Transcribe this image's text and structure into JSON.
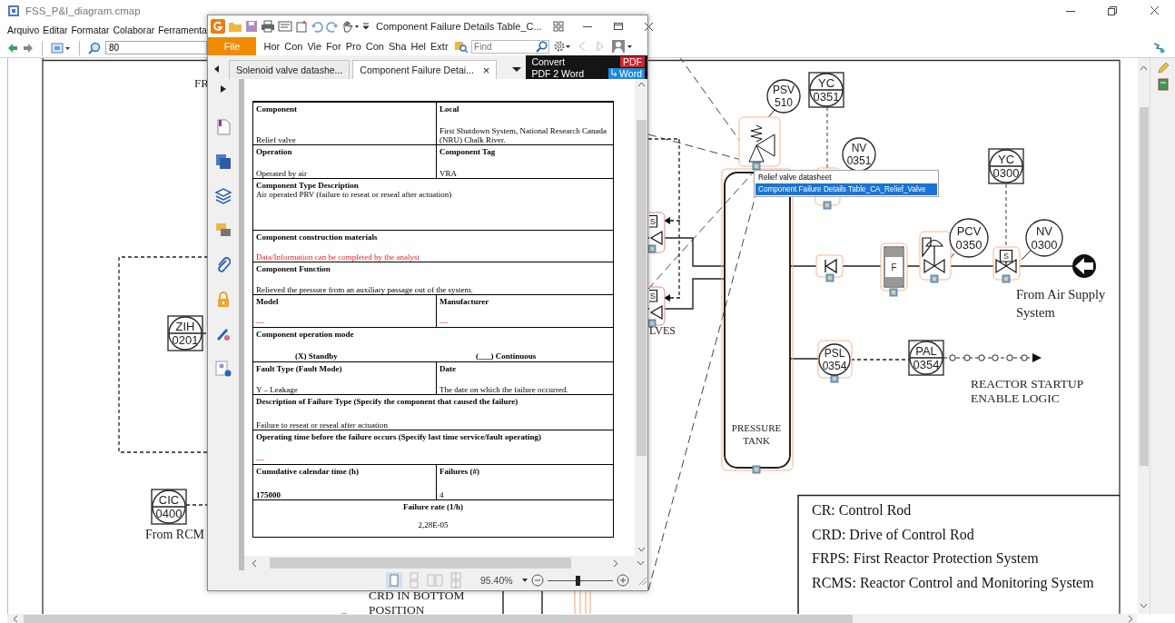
{
  "window": {
    "title": "FSS_P&I_diagram.cmap"
  },
  "menu": [
    "Arquivo",
    "Editar",
    "Formatar",
    "Colaborar",
    "Ferramenta"
  ],
  "toolbar": {
    "zoom_value": "80"
  },
  "diagram": {
    "instruments": [
      {
        "kind": "field",
        "tag": "PSV",
        "number": "510"
      },
      {
        "kind": "panel",
        "tag": "YC",
        "number": "0351"
      },
      {
        "kind": "field",
        "tag": "NV",
        "number": "0351"
      },
      {
        "kind": "panel",
        "tag": "YC",
        "number": "0300"
      },
      {
        "kind": "field",
        "tag": "PCV",
        "number": "0350"
      },
      {
        "kind": "field",
        "tag": "NV",
        "number": "0300"
      },
      {
        "kind": "field",
        "tag": "PSL",
        "number": "0354"
      },
      {
        "kind": "panel",
        "tag": "PAL",
        "number": "0354"
      },
      {
        "kind": "panel",
        "tag": "ZIH",
        "number": "0201"
      },
      {
        "kind": "panel",
        "tag": "CIC",
        "number": "0400"
      }
    ],
    "valve_marks": [
      "S",
      "S",
      "F",
      "S"
    ],
    "labels": [
      {
        "lines": [
          "FR"
        ]
      },
      {
        "lines": [
          "LVES"
        ]
      },
      {
        "lines": [
          "From RCM"
        ]
      },
      {
        "lines": [
          "CRD IN BOTTOM",
          "POSITION"
        ]
      },
      {
        "lines": [
          "PRESSURE",
          "TANK"
        ]
      },
      {
        "lines": [
          "From Air Supply",
          "System"
        ]
      },
      {
        "lines": [
          "REACTOR STARTUP",
          "ENABLE LOGIC"
        ]
      }
    ],
    "legend": [
      "CR: Control Rod",
      "CRD: Drive of Control Rod",
      "FRPS: First Reactor Protection  System",
      "RCMS: Reactor Control and Monitoring System"
    ],
    "popup": {
      "items": [
        {
          "label": "Relief valve datasheet",
          "selected": false
        },
        {
          "label": "Component Failure Details Table_CA_Relief_Valve",
          "selected": true
        }
      ]
    }
  },
  "pdf_window": {
    "title": "Component Failure Details Table_C...",
    "file_button": "File",
    "ribbon_tabs": [
      "Hor",
      "Con",
      "Vie",
      "For",
      "Pro",
      "Con",
      "Sha",
      "Hel",
      "Extr"
    ],
    "search": {
      "placeholder": "Find"
    },
    "tabs": [
      {
        "label": "Solenoid valve datashe...",
        "selected": false
      },
      {
        "label": "Component Failure Detai...",
        "selected": true
      }
    ],
    "close_tab": "×",
    "ad": {
      "line1": "Convert",
      "badge1": "PDF",
      "line2": "PDF 2 Word",
      "badge2": "Word"
    },
    "table": {
      "rows": [
        {
          "kind": "pair",
          "cells": [
            {
              "label": "Component",
              "value": "Relief valve",
              "hint": false,
              "strong": false
            },
            {
              "label": "Local",
              "value": "First Shutdown System, National Research Canada (NRU) Chalk River.",
              "hint": false,
              "strong": false
            }
          ]
        },
        {
          "kind": "pair",
          "cells": [
            {
              "label": "Operation",
              "value": "Operated by air",
              "hint": false,
              "strong": false
            },
            {
              "label": "Component Tag",
              "value": "VRA",
              "hint": false,
              "strong": false
            }
          ]
        },
        {
          "kind": "stacked",
          "cells": [
            {
              "label": "Component Type Description",
              "value": "Air operated PRV (failure to reseat or reseal after actuation)",
              "hint": false,
              "strong": false
            }
          ]
        },
        {
          "kind": "pair",
          "cells": [
            {
              "label": "Component construction materials",
              "value": "Data/Information can be completed by the analyst",
              "hint": true,
              "strong": false
            }
          ]
        },
        {
          "kind": "pair",
          "cells": [
            {
              "label": "Component Function",
              "value": "Relieved the pressure from an auxiliary passage out of the system.",
              "hint": false,
              "strong": false
            }
          ]
        },
        {
          "kind": "pair",
          "cells": [
            {
              "label": "Model",
              "value": "---",
              "hint": true,
              "strong": false
            },
            {
              "label": "Manufacturer",
              "value": "---",
              "hint": true,
              "strong": false
            }
          ]
        },
        {
          "kind": "options",
          "cells": [
            {
              "label": "Component operation mode"
            }
          ],
          "options": [
            "(X) Standby",
            "(___) Continuous"
          ]
        },
        {
          "kind": "pair",
          "cells": [
            {
              "label": "Fault Type (Fault Mode)",
              "value": "Y – Leakage",
              "hint": false,
              "strong": false
            },
            {
              "label": "Date",
              "value": "The date on which the failure occurred.",
              "hint": false,
              "strong": false
            }
          ]
        },
        {
          "kind": "pair",
          "cells": [
            {
              "label": "Description of Failure Type (Specify the component that caused the failure)",
              "value": "Failure to reseat or reseal after actuation",
              "hint": false,
              "strong": false
            }
          ]
        },
        {
          "kind": "pair",
          "cells": [
            {
              "label": "Operating time before the failure occurs (Specify last time service/fault operating)",
              "value": "---",
              "hint": true,
              "strong": false
            }
          ]
        },
        {
          "kind": "pair",
          "cells": [
            {
              "label": "Cumulative calendar time (h)",
              "value": "175000",
              "hint": false,
              "strong": true
            },
            {
              "label": "Failures (#)",
              "value": "4",
              "hint": false,
              "strong": false
            }
          ]
        },
        {
          "kind": "centered",
          "cells": [
            {
              "label": "Failure rate (1/h)",
              "value": "2,28E-05",
              "hint": false,
              "strong": false
            }
          ]
        }
      ]
    },
    "zoom_text": "95.40%",
    "zoom_slider": {
      "level": 0.46
    }
  }
}
